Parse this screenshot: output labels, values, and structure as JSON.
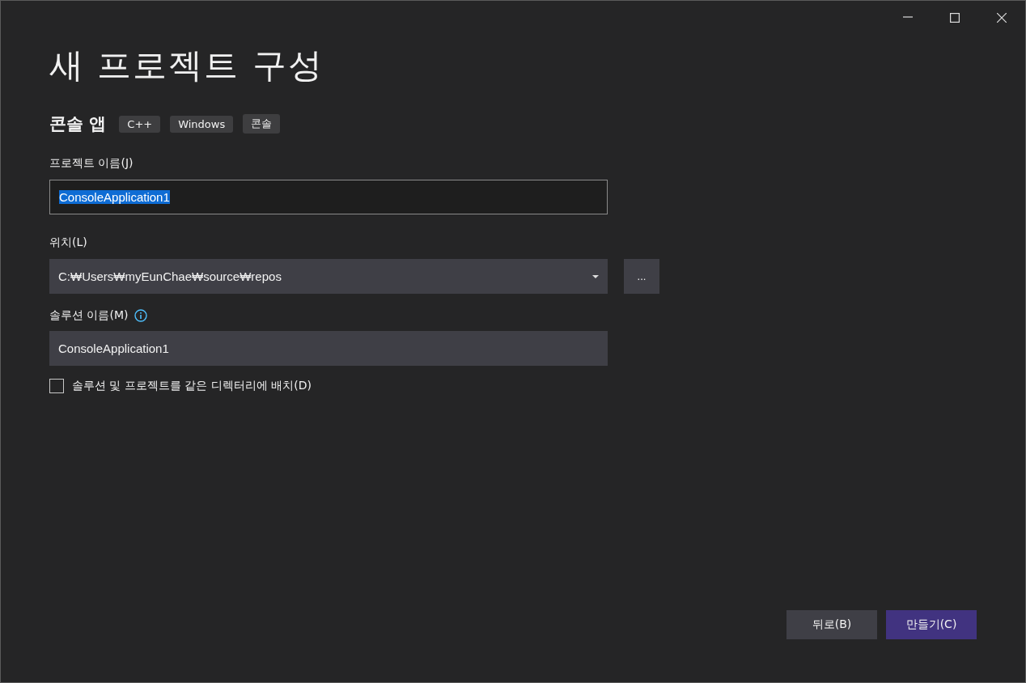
{
  "window_controls": [
    {
      "kind": "minimize"
    },
    {
      "kind": "maximize"
    },
    {
      "kind": "close"
    }
  ],
  "title": "새 프로젝트 구성",
  "template": {
    "name": "콘솔 앱",
    "tags": [
      "C++",
      "Windows",
      "콘솔"
    ]
  },
  "project_name": {
    "label": "프로젝트 이름(J)",
    "value": "ConsoleApplication1",
    "text_selected": true
  },
  "location": {
    "label": "위치(L)",
    "value": "C:₩Users₩myEunChae₩source₩repos",
    "browse": "..."
  },
  "solution_name": {
    "label": "솔루션 이름(M)",
    "value": "ConsoleApplication1"
  },
  "same_directory": {
    "label": "솔루션 및 프로젝트를 같은 디렉터리에 배치(D)",
    "checked": false
  },
  "buttons": [
    {
      "label": "뒤로(B)",
      "kind": "secondary"
    },
    {
      "label": "만들기(C)",
      "kind": "primary"
    }
  ]
}
